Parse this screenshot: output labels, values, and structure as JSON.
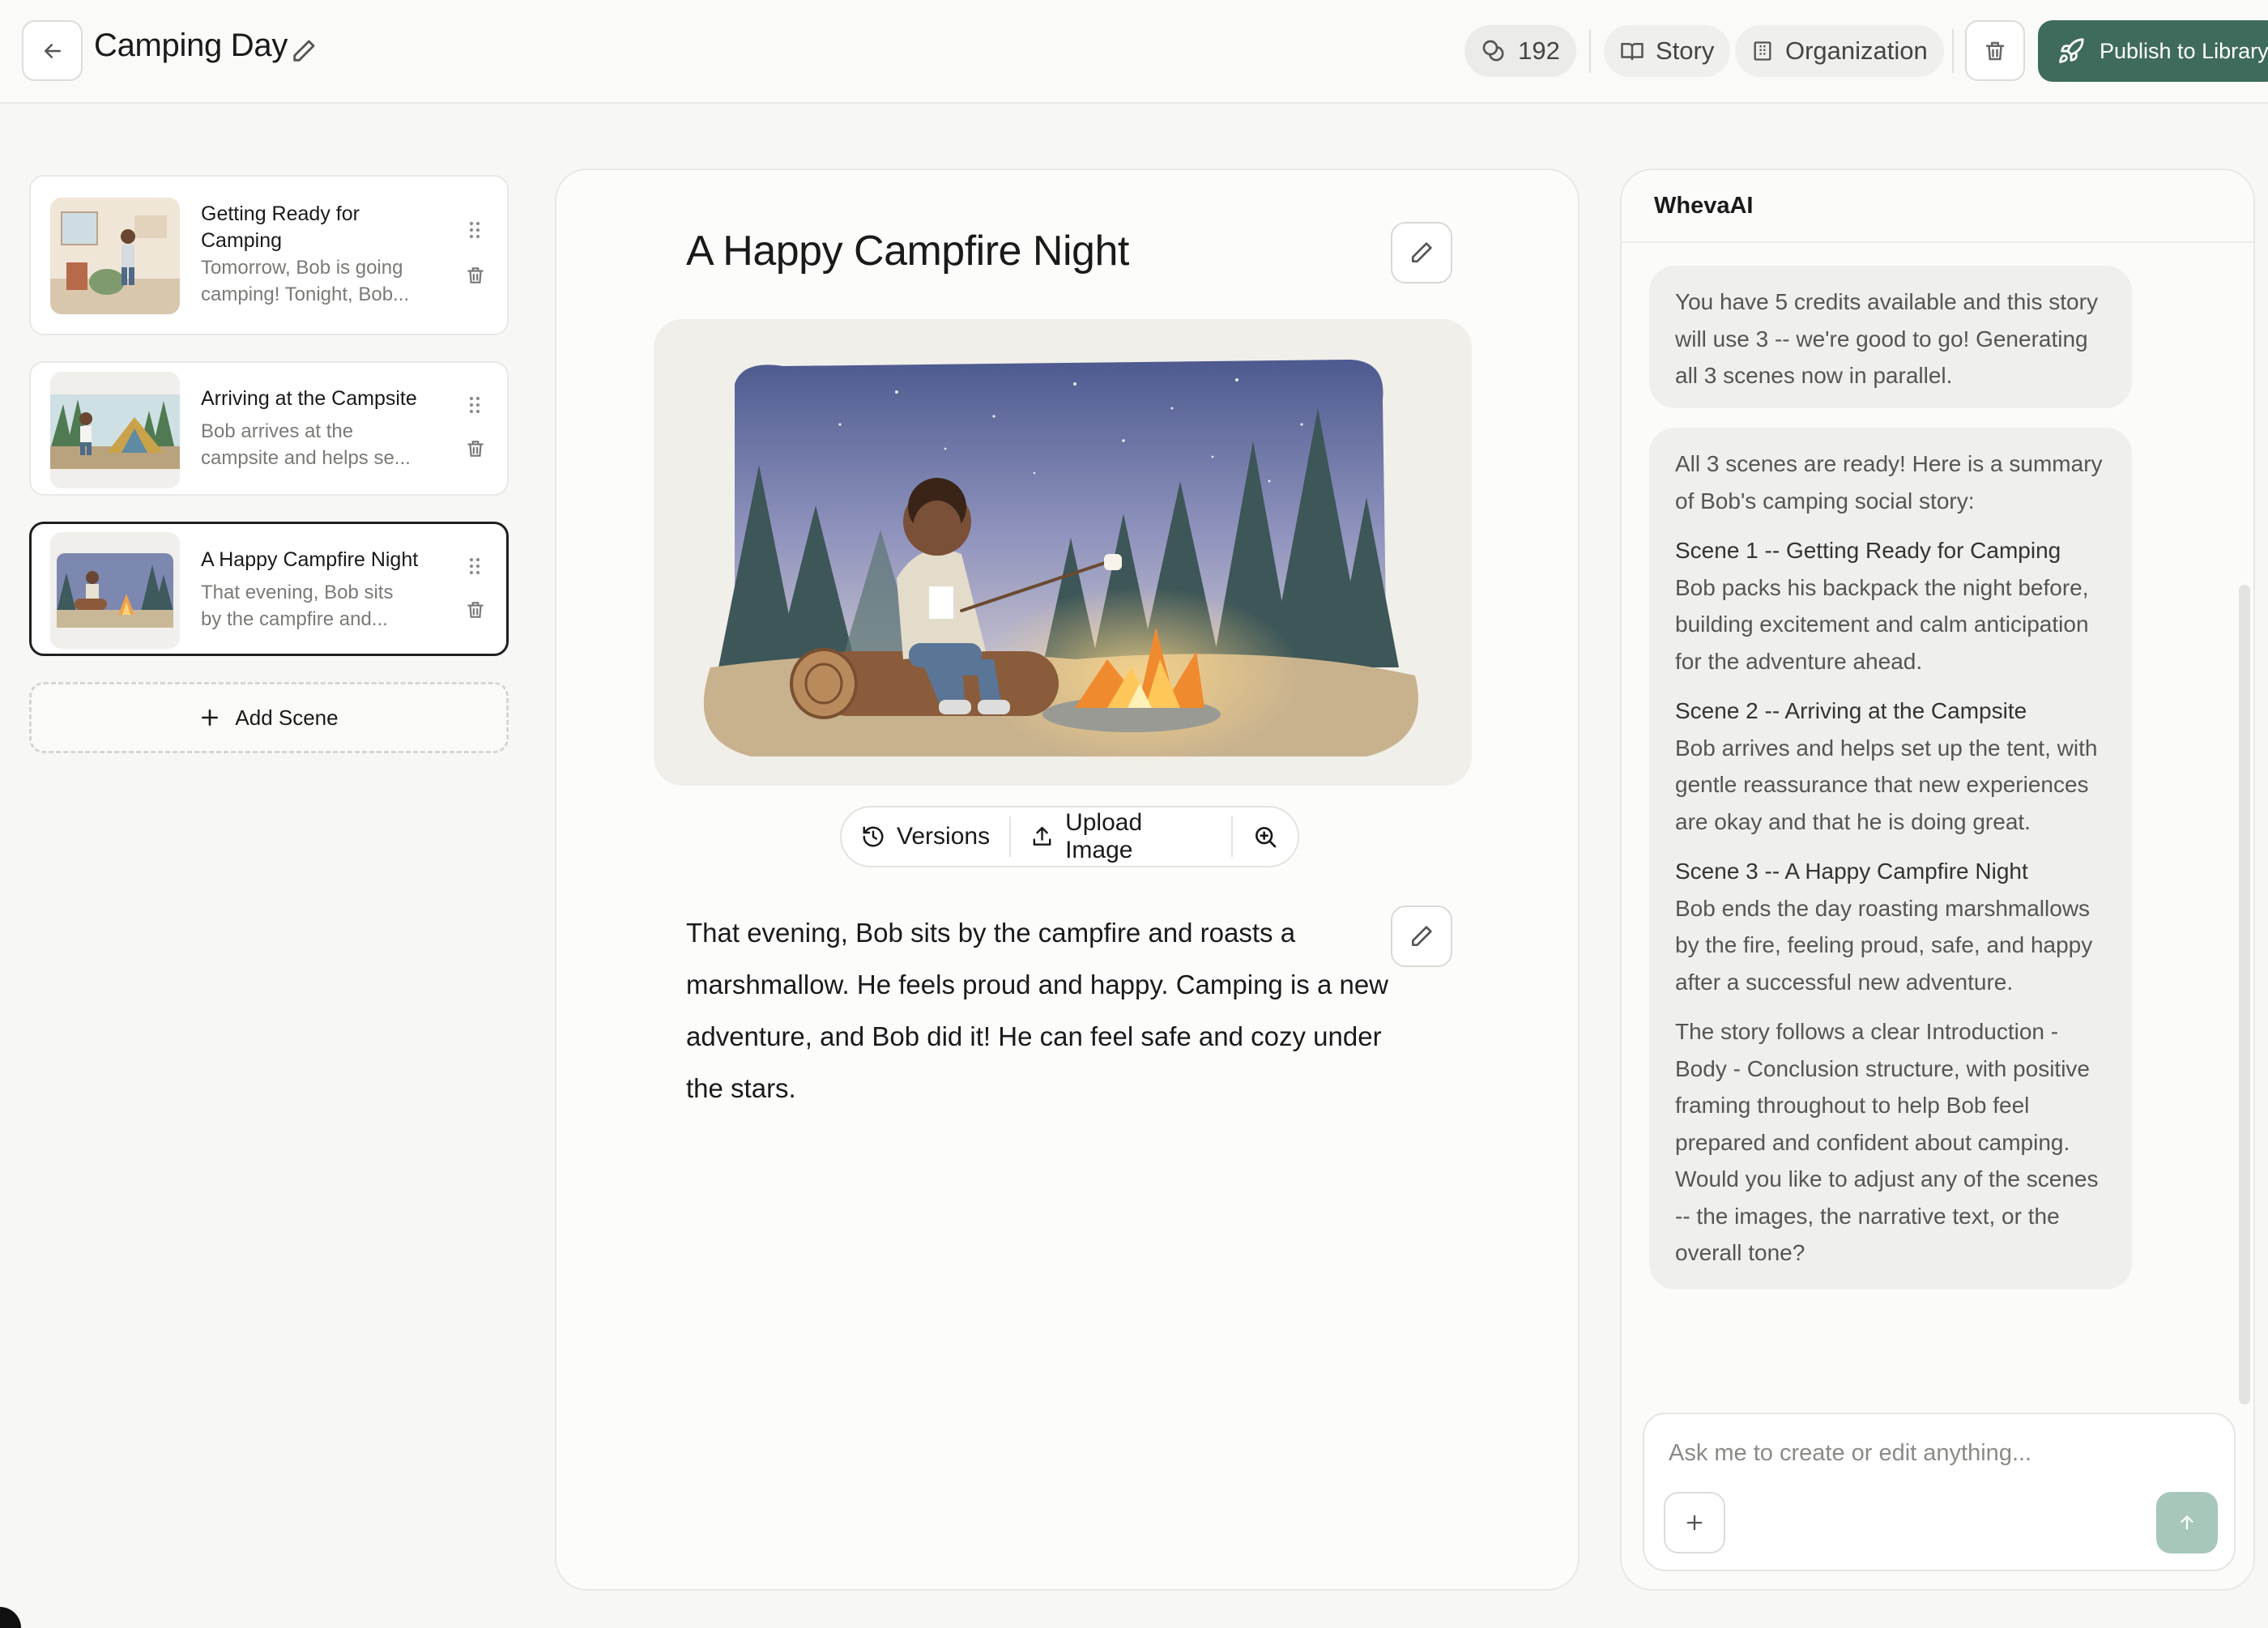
{
  "header": {
    "title": "Camping Day",
    "credits": "192",
    "story_label": "Story",
    "organization_label": "Organization",
    "publish_label": "Publish to Library"
  },
  "scenes": [
    {
      "title": "Getting Ready for Camping",
      "desc_1": "Tomorrow, Bob is going",
      "desc_2": "camping! Tonight, Bob..."
    },
    {
      "title": "Arriving at the Campsite",
      "desc_1": "Bob arrives at the",
      "desc_2": "campsite and helps se..."
    },
    {
      "title": "A Happy Campfire Night",
      "desc_1": "That evening, Bob sits",
      "desc_2": "by the campfire and..."
    }
  ],
  "add_scene_label": "Add Scene",
  "editor": {
    "heading": "A Happy Campfire Night",
    "versions_label": "Versions",
    "upload_label": "Upload Image",
    "text": "That evening, Bob sits by the campfire and roasts a marshmallow. He feels proud and happy. Camping is a new adventure, and Bob did it! He can feel safe and cozy under the stars."
  },
  "ai": {
    "title": "WhevaAI",
    "msg1": "You have 5 credits available and this story will use 3 -- we're good to go! Generating all 3 scenes now in parallel.",
    "msg2_intro": "All 3 scenes are ready! Here is a summary of Bob's camping social story:",
    "s1_head": "Scene 1 -- Getting Ready for Camping",
    "s1_body": "Bob packs his backpack the night before, building excitement and calm anticipation for the adventure ahead.",
    "s2_head": "Scene 2 -- Arriving at the Campsite",
    "s2_body": "Bob arrives and helps set up the tent, with gentle reassurance that new experiences are okay and that he is doing great.",
    "s3_head": "Scene 3 -- A Happy Campfire Night",
    "s3_body": "Bob ends the day roasting marshmallows by the fire, feeling proud, safe, and happy after a successful new adventure.",
    "outro": "The story follows a clear Introduction - Body - Conclusion structure, with positive framing throughout to help Bob feel prepared and confident about camping. Would you like to adjust any of the scenes -- the images, the narrative text, or the overall tone?",
    "input_placeholder": "Ask me to create or edit anything..."
  },
  "colors": {
    "accent": "#3f6b5c",
    "send_disabled": "#a8c7bb",
    "bubble": "#efefec"
  },
  "icons": [
    "arrow-left-icon",
    "pencil-icon",
    "coins-icon",
    "book-icon",
    "building-icon",
    "trash-icon",
    "rocket-icon",
    "grip-icon",
    "plus-icon",
    "history-icon",
    "upload-icon",
    "zoom-in-icon",
    "arrow-up-icon"
  ]
}
